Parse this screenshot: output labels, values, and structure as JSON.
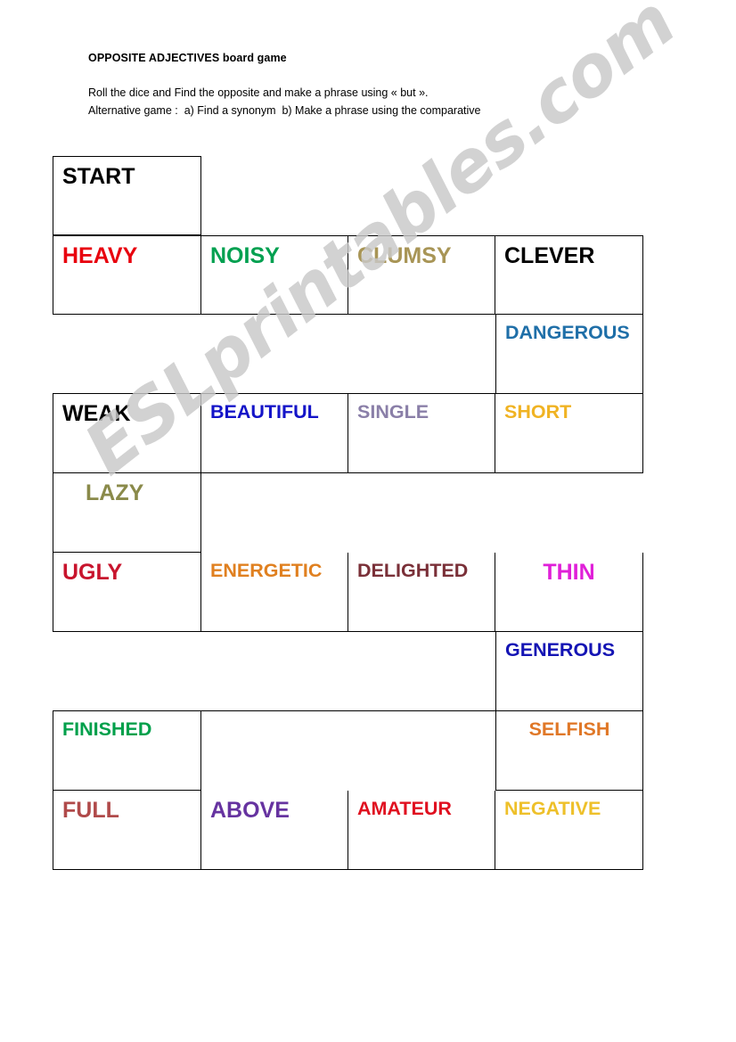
{
  "document": {
    "title": "OPPOSITE ADJECTIVES board game",
    "instructions": [
      "Roll the dice and Find the opposite and make a phrase using « but ».",
      "Alternative game :  a) Find a synonym  b) Make a phrase using the comparative"
    ]
  },
  "watermark": {
    "text": "ESLprintables.com",
    "color": "#c9c9c9"
  },
  "board": {
    "columns": 4,
    "rows": [
      {
        "id": "row-start",
        "cells": [
          {
            "label": "START",
            "color": "#000000",
            "bordered": true,
            "align": "left"
          },
          {
            "label": "",
            "color": "",
            "bordered": false,
            "align": "left"
          },
          {
            "label": "",
            "color": "",
            "bordered": false,
            "align": "left"
          },
          {
            "label": "",
            "color": "",
            "bordered": false,
            "align": "left"
          }
        ]
      },
      {
        "id": "row-heavy",
        "cells": [
          {
            "label": "HEAVY",
            "color": "#E8000D",
            "bordered": true,
            "align": "left"
          },
          {
            "label": "NOISY",
            "color": "#00A050",
            "bordered": true,
            "align": "left"
          },
          {
            "label": "CLUMSY",
            "color": "#A89556",
            "bordered": true,
            "align": "left"
          },
          {
            "label": "CLEVER",
            "color": "#000000",
            "bordered": true,
            "align": "left"
          }
        ]
      },
      {
        "id": "row-dangerous",
        "cells": [
          {
            "label": "",
            "color": "",
            "bordered": false,
            "align": "left"
          },
          {
            "label": "",
            "color": "",
            "bordered": false,
            "align": "left"
          },
          {
            "label": "",
            "color": "",
            "bordered": false,
            "align": "left"
          },
          {
            "label": "DANGEROUS",
            "color": "#1F6FA8",
            "bordered": true,
            "align": "left"
          }
        ]
      },
      {
        "id": "row-weak",
        "cells": [
          {
            "label": "WEAK",
            "color": "#000000",
            "bordered": true,
            "align": "left"
          },
          {
            "label": "BEAUTIFUL",
            "color": "#1414C8",
            "bordered": true,
            "align": "left"
          },
          {
            "label": "SINGLE",
            "color": "#8A7FA8",
            "bordered": true,
            "align": "left"
          },
          {
            "label": "SHORT",
            "color": "#F0B323",
            "bordered": true,
            "align": "left"
          }
        ]
      },
      {
        "id": "row-lazy",
        "cells": [
          {
            "label": "LAZY",
            "color": "#8A8A4A",
            "bordered": true,
            "align": "indent"
          },
          {
            "label": "",
            "color": "",
            "bordered": false,
            "align": "left"
          },
          {
            "label": "",
            "color": "",
            "bordered": false,
            "align": "left"
          },
          {
            "label": "",
            "color": "",
            "bordered": false,
            "align": "left"
          }
        ]
      },
      {
        "id": "row-ugly",
        "cells": [
          {
            "label": "UGLY",
            "color": "#C8142D",
            "bordered": true,
            "align": "left"
          },
          {
            "label": "ENERGETIC",
            "color": "#E08020",
            "bordered": true,
            "align": "left"
          },
          {
            "label": "DELIGHTED",
            "color": "#7A3038",
            "bordered": true,
            "align": "left"
          },
          {
            "label": "THIN",
            "color": "#E020D8",
            "bordered": true,
            "align": "center"
          }
        ]
      },
      {
        "id": "row-generous",
        "cells": [
          {
            "label": "",
            "color": "",
            "bordered": false,
            "align": "left"
          },
          {
            "label": "",
            "color": "",
            "bordered": false,
            "align": "left"
          },
          {
            "label": "",
            "color": "",
            "bordered": false,
            "align": "left"
          },
          {
            "label": "GENEROUS",
            "color": "#1414B4",
            "bordered": true,
            "align": "left"
          }
        ]
      },
      {
        "id": "row-finished",
        "cells": [
          {
            "label": "FINISHED",
            "color": "#00A04B",
            "bordered": true,
            "align": "left"
          },
          {
            "label": "",
            "color": "",
            "bordered": false,
            "align": "left"
          },
          {
            "label": "",
            "color": "",
            "bordered": false,
            "align": "left"
          },
          {
            "label": "SELFISH",
            "color": "#E07828",
            "bordered": true,
            "align": "center"
          }
        ]
      },
      {
        "id": "row-full",
        "cells": [
          {
            "label": "FULL",
            "color": "#B04A4A",
            "bordered": true,
            "align": "left"
          },
          {
            "label": "ABOVE",
            "color": "#6633A0",
            "bordered": true,
            "align": "left"
          },
          {
            "label": "AMATEUR",
            "color": "#E01020",
            "bordered": true,
            "align": "left"
          },
          {
            "label": "NEGATIVE",
            "color": "#EEC02A",
            "bordered": true,
            "align": "left"
          }
        ]
      }
    ]
  }
}
